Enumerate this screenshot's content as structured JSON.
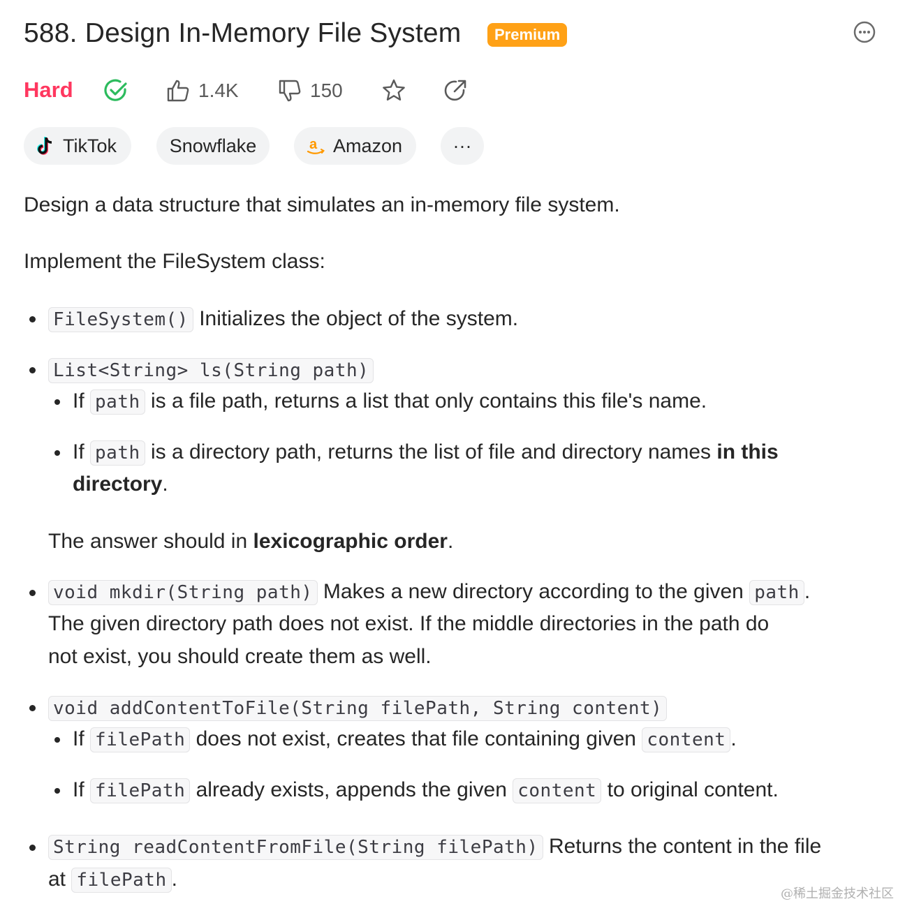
{
  "problem": {
    "title": "588. Design In-Memory File System",
    "premium_label": "Premium",
    "difficulty": "Hard",
    "likes": "1.4K",
    "dislikes": "150"
  },
  "tags": [
    {
      "label": "TikTok",
      "icon": "tiktok-icon"
    },
    {
      "label": "Snowflake"
    },
    {
      "label": "Amazon",
      "icon": "amazon-icon"
    },
    {
      "label": "···"
    }
  ],
  "description": {
    "intro": "Design a data structure that simulates an in-memory file system.",
    "implement": "Implement the FileSystem class:",
    "b1_code": "FileSystem()",
    "b1_text": "Initializes the object of the system.",
    "b2_code": "List<String> ls(String path)",
    "b2_s1_pre": "If",
    "b2_s1_code": "path",
    "b2_s1_text": "is a file path, returns a list that only contains this file's name.",
    "b2_s2_pre": "If",
    "b2_s2_code": "path",
    "b2_s2_text": "is a directory path, returns the list of file and directory names",
    "b2_s2_bold1": "in this",
    "b2_s2_bold2": "directory",
    "b2_s2_end": ".",
    "b2_note_text": "The answer should in",
    "b2_note_bold": "lexicographic order",
    "b2_note_end": ".",
    "b3_code": "void mkdir(String path)",
    "b3_text1": "Makes a new directory according to the given",
    "b3_code2": "path",
    "b3_end": ".",
    "b3_line2": "The given directory path does not exist. If the middle directories in the path do",
    "b3_line3": "not exist, you should create them as well.",
    "b4_code": "void addContentToFile(String filePath, String content)",
    "b4_s1_pre": "If",
    "b4_s1_code": "filePath",
    "b4_s1_text": "does not exist, creates that file containing given",
    "b4_s1_code2": "content",
    "b4_s1_end": ".",
    "b4_s2_pre": "If",
    "b4_s2_code": "filePath",
    "b4_s2_text": "already exists, appends the given",
    "b4_s2_code2": "content",
    "b4_s2_end": "to original content.",
    "b5_code": "String readContentFromFile(String filePath)",
    "b5_text": "Returns the content in the file",
    "b5_line2_pre": "at",
    "b5_line2_code": "filePath",
    "b5_line2_end": "."
  },
  "watermark": "@稀土掘金技术社区",
  "colors": {
    "hard": "#ff375f",
    "premium": "#ffa116",
    "solved": "#2cbb5d"
  }
}
